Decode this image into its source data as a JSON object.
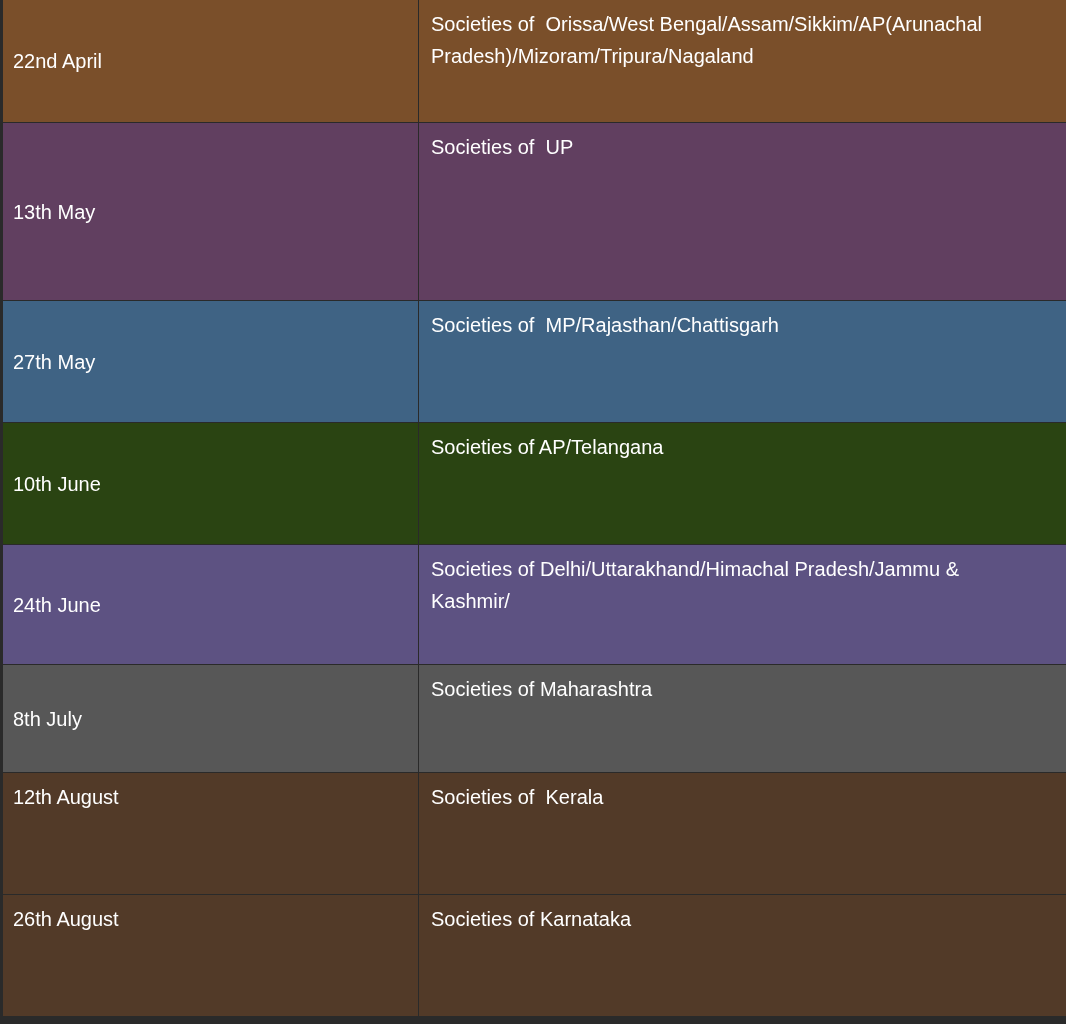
{
  "table": {
    "rows": [
      {
        "date": "22nd April",
        "societies": "Societies of  Orissa/West Bengal/Assam/Sikkim/AP(Arunachal Pradesh)/Mizoram/Tripura/Nagaland",
        "color": "#7a4f2a",
        "date_centered": true
      },
      {
        "date": "13th May",
        "societies": "Societies of  UP",
        "color": "#613f60",
        "date_centered": true
      },
      {
        "date": "27th May",
        "societies": "Societies of  MP/Rajasthan/Chattisgarh",
        "color": "#3f6384",
        "date_centered": true
      },
      {
        "date": "10th June",
        "societies": "Societies of AP/Telangana",
        "color": "#2a4412",
        "date_centered": true
      },
      {
        "date": "24th June",
        "societies": "Societies of Delhi/Uttarakhand/Himachal Pradesh/Jammu & Kashmir/",
        "color": "#5d5282",
        "date_centered": true
      },
      {
        "date": "8th July",
        "societies": "Societies of Maharashtra",
        "color": "#575757",
        "date_centered": true
      },
      {
        "date": "12th August",
        "societies": "Societies of  Kerala",
        "color": "#523a28",
        "date_centered": false
      },
      {
        "date": "26th August",
        "societies": "Societies of Karnataka",
        "color": "#523a28",
        "date_centered": false
      }
    ]
  }
}
